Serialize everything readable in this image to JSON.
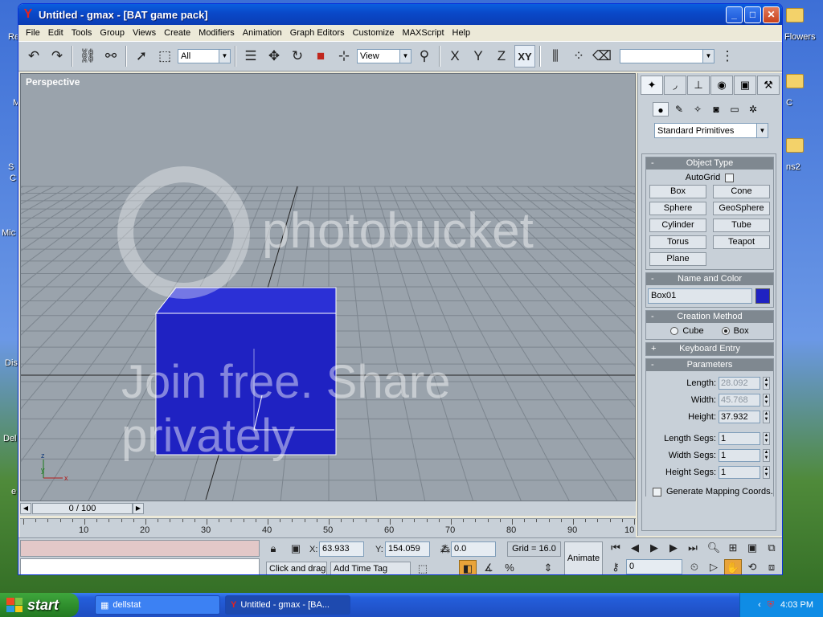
{
  "desktop": {
    "frags": [
      "Re",
      "M",
      "S",
      "C",
      "Mic",
      "Dis",
      "Del",
      "e",
      "Flowers",
      "C",
      "ns2"
    ]
  },
  "window": {
    "title": "Untitled - gmax - [BAT game pack]",
    "minimize_icon": "minimize-icon",
    "maximize_icon": "maximize-icon",
    "close_icon": "close-icon"
  },
  "menu": [
    "File",
    "Edit",
    "Tools",
    "Group",
    "Views",
    "Create",
    "Modifiers",
    "Animation",
    "Graph Editors",
    "Customize",
    "MAXScript",
    "Help"
  ],
  "toolbar": {
    "selection_filter": "All",
    "ref_coord": "View",
    "axis_x": "X",
    "axis_y": "Y",
    "axis_z": "Z",
    "axis_xy": "XY",
    "named_selection": ""
  },
  "viewport": {
    "label": "Perspective",
    "box_color": "#1f22c2",
    "watermark_brand": "photobucket",
    "watermark_tagline": "Join free. Share privately"
  },
  "command_panel": {
    "category": "Standard Primitives",
    "object_type_title": "Object Type",
    "autogrid_label": "AutoGrid",
    "buttons": [
      "Box",
      "Cone",
      "Sphere",
      "GeoSphere",
      "Cylinder",
      "Tube",
      "Torus",
      "Teapot",
      "Plane"
    ],
    "name_color_title": "Name and Color",
    "object_name": "Box01",
    "object_color": "#1f22c2",
    "creation_method_title": "Creation Method",
    "method_cube": "Cube",
    "method_box": "Box",
    "keyboard_entry_title": "Keyboard Entry",
    "parameters_title": "Parameters",
    "length_label": "Length:",
    "length_value": "28.092",
    "width_label": "Width:",
    "width_value": "45.768",
    "height_label": "Height:",
    "height_value": "37.932",
    "length_segs_label": "Length Segs:",
    "length_segs_value": "1",
    "width_segs_label": "Width Segs:",
    "width_segs_value": "1",
    "height_segs_label": "Height Segs:",
    "height_segs_value": "1",
    "gen_mapping_label": "Generate Mapping Coords."
  },
  "timeline": {
    "frame_display": "0 / 100",
    "ticks": [
      "10",
      "20",
      "30",
      "40",
      "50",
      "60",
      "70",
      "80",
      "90",
      "10"
    ]
  },
  "status": {
    "x_label": "X:",
    "x_value": "63.933",
    "y_label": "Y:",
    "y_value": "154.059",
    "z_label": "Z:",
    "z_value": "0.0",
    "grid": "Grid = 16.0",
    "animate": "Animate",
    "prompt": "Click and drag",
    "add_time_tag": "Add Time Tag",
    "current_frame": "0"
  },
  "taskbar": {
    "start": "start",
    "tasks": [
      "dellstat",
      "Untitled - gmax - [BA..."
    ],
    "clock": "4:03 PM"
  }
}
